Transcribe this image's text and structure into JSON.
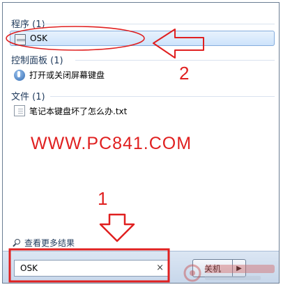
{
  "groups": {
    "programs": {
      "title": "程序 (1)"
    },
    "control_panel": {
      "title": "控制面板 (1)"
    },
    "files": {
      "title": "文件 (1)"
    }
  },
  "results": {
    "program_item": {
      "label": "OSK",
      "icon": "keyboard-icon",
      "selected": true
    },
    "control_panel_item": {
      "label": "打开或关闭屏幕键盘",
      "icon": "control-panel-icon"
    },
    "file_item": {
      "label": "笔记本键盘坏了怎么办.txt",
      "icon": "text-document-icon"
    }
  },
  "more_results_label": "查看更多结果",
  "search": {
    "value": "OSK",
    "clear_glyph": "×"
  },
  "shutdown": {
    "label": "关机",
    "arrow_glyph": "▶"
  },
  "annotations": {
    "watermark_text": "WWW.PC841.COM",
    "step_1": "1",
    "step_2": "2",
    "color": "#e02020"
  }
}
